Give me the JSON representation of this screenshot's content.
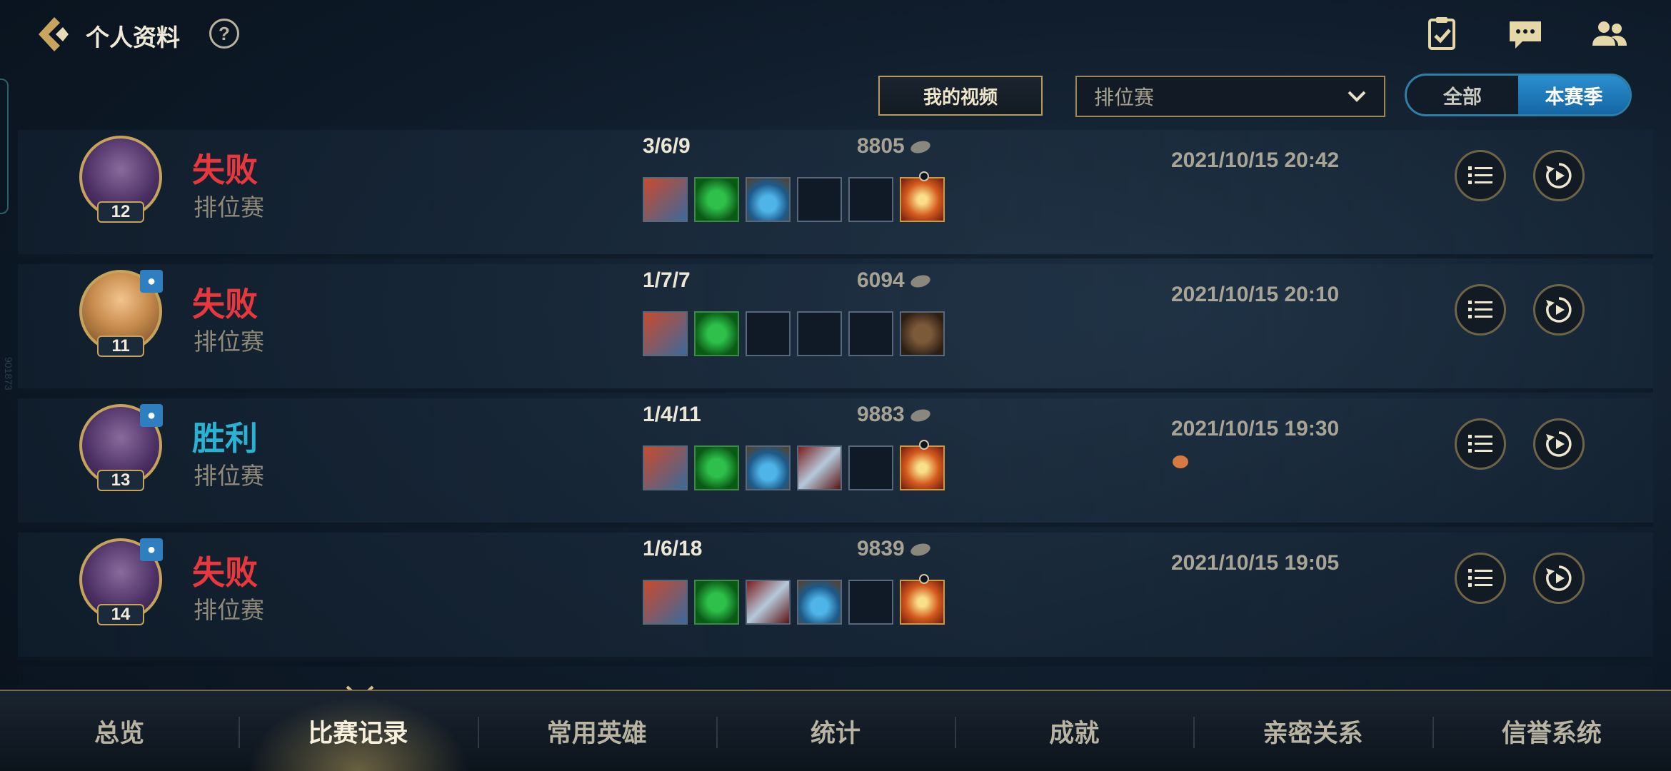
{
  "header": {
    "title": "个人资料",
    "help_symbol": "?",
    "icons": [
      "checklist-icon",
      "chat-icon",
      "friends-icon"
    ]
  },
  "side_label": "901873",
  "filters": {
    "video_button": "我的视频",
    "mode_select": "排位赛",
    "season_toggle": {
      "all": "全部",
      "this_season": "本赛季",
      "selected": "本赛季"
    }
  },
  "matches": [
    {
      "result": "失败",
      "mode": "排位赛",
      "level": "12",
      "kda": "3/6/9",
      "gold": "8805",
      "time": "2021/10/15 20:42"
    },
    {
      "result": "失败",
      "mode": "排位赛",
      "level": "11",
      "kda": "1/7/7",
      "gold": "6094",
      "time": "2021/10/15 20:10"
    },
    {
      "result": "胜利",
      "mode": "排位赛",
      "level": "13",
      "kda": "1/4/11",
      "gold": "9883",
      "time": "2021/10/15 19:30"
    },
    {
      "result": "失败",
      "mode": "排位赛",
      "level": "14",
      "kda": "1/6/18",
      "gold": "9839",
      "time": "2021/10/15 19:05"
    }
  ],
  "nav": [
    "总览",
    "比赛记录",
    "常用英雄",
    "统计",
    "成就",
    "亲密关系",
    "信誉系统"
  ],
  "nav_active": "比赛记录",
  "colors": {
    "loss": "#e8383d",
    "win": "#29b2d2",
    "accent_gold": "#c5a35c",
    "toggle_blue": "#2a8fd0"
  }
}
